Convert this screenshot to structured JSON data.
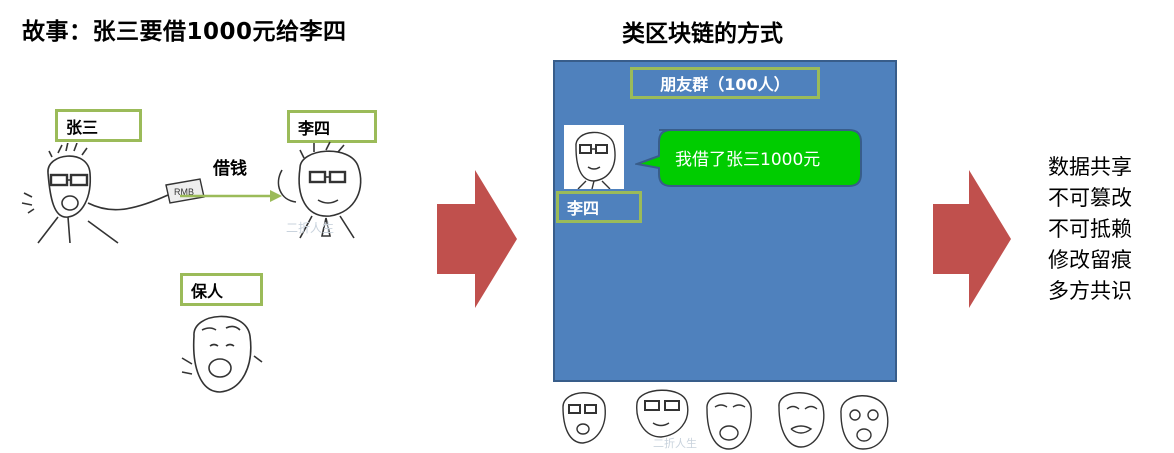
{
  "left": {
    "title": "故事：张三要借1000元给李四",
    "zhangsan": "张三",
    "lisi": "李四",
    "guarantor": "保人",
    "lend_label": "借钱",
    "rmb_note": "RMB",
    "watermark": "二折人生"
  },
  "middle": {
    "title": "类区块链的方式",
    "group_label": "朋友群（100人）",
    "message": "我借了张三1000元",
    "sender": "李四",
    "watermark": "二折人生"
  },
  "right": {
    "properties": [
      "数据共享",
      "不可篡改",
      "不可抵赖",
      "修改留痕",
      "多方共识"
    ]
  },
  "colors": {
    "panel_blue": "#4f81bd",
    "label_border_green": "#9bbb59",
    "bubble_green": "#00cc00",
    "arrow_red": "#c0504d"
  }
}
